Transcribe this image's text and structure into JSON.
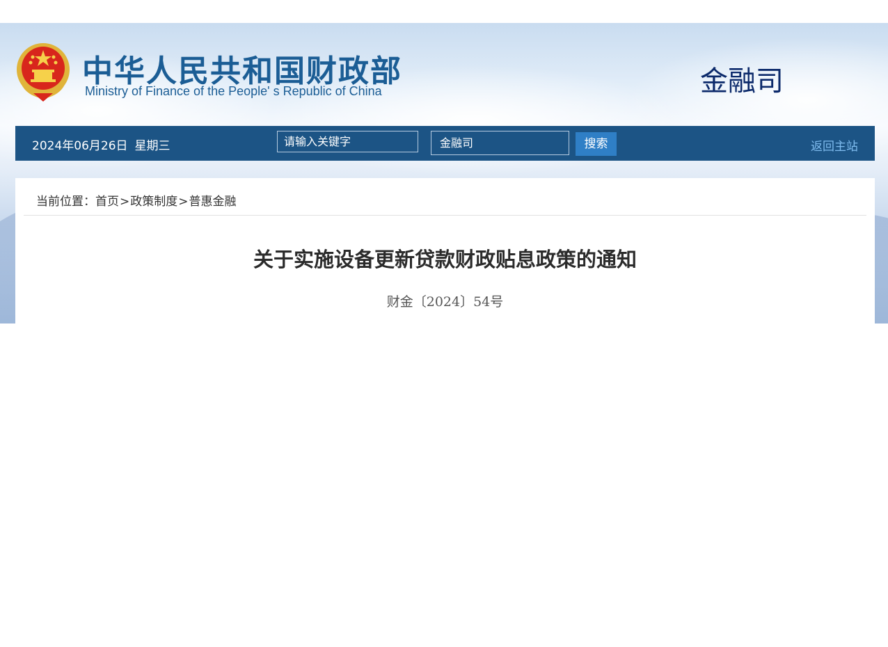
{
  "header": {
    "ministry_name_cn": "中华人民共和国财政部",
    "ministry_name_en": "Ministry of Finance of the People' s Republic of China",
    "department": "金融司",
    "emblem_icon": "national-emblem-icon"
  },
  "navbar": {
    "date": "2024年06月26日",
    "weekday": "星期三",
    "search_placeholder": "请输入关键字",
    "search_scope": "金融司",
    "search_button": "搜索",
    "home_link": "返回主站"
  },
  "breadcrumb": {
    "prefix": "当前位置：",
    "items": [
      "首页",
      "政策制度",
      "普惠金融"
    ],
    "separator": ">"
  },
  "article": {
    "title": "关于实施设备更新贷款财政贴息政策的通知",
    "doc_number": "财金〔2024〕54号"
  },
  "colors": {
    "navbar_bg": "#1c5485",
    "brand_blue": "#1b5d95",
    "department_text": "#0c2a6b",
    "search_button_bg": "#2f7fc6",
    "home_link": "#7fbcef"
  }
}
